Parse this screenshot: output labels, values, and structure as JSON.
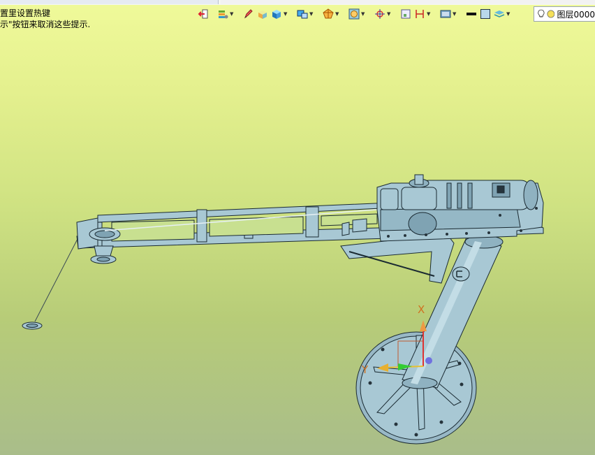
{
  "hints": {
    "line1": "置里设置热键",
    "line2": "示\"按钮来取消这些提示."
  },
  "toolbar": {
    "icons": [
      "exit-icon",
      "layer-settings-icon",
      "pencil-icon",
      "box-solid-icon",
      "cube-shaded-icon",
      "view-orient-icon",
      "wireframe-icon",
      "section-icon",
      "snap-icon",
      "sketch-icon",
      "dimension-icon",
      "render-icon",
      "line-color-icon",
      "fill-color-icon",
      "layer-stack-icon"
    ],
    "layer_label": "图层0000"
  },
  "triad": {
    "x_label": "X",
    "y_label": "Y"
  },
  "colors": {
    "model_fill": "#a8c8d4",
    "model_stroke": "#1a2a32",
    "background_top": "#f0fa9a",
    "background_bottom": "#a9bd8a"
  }
}
